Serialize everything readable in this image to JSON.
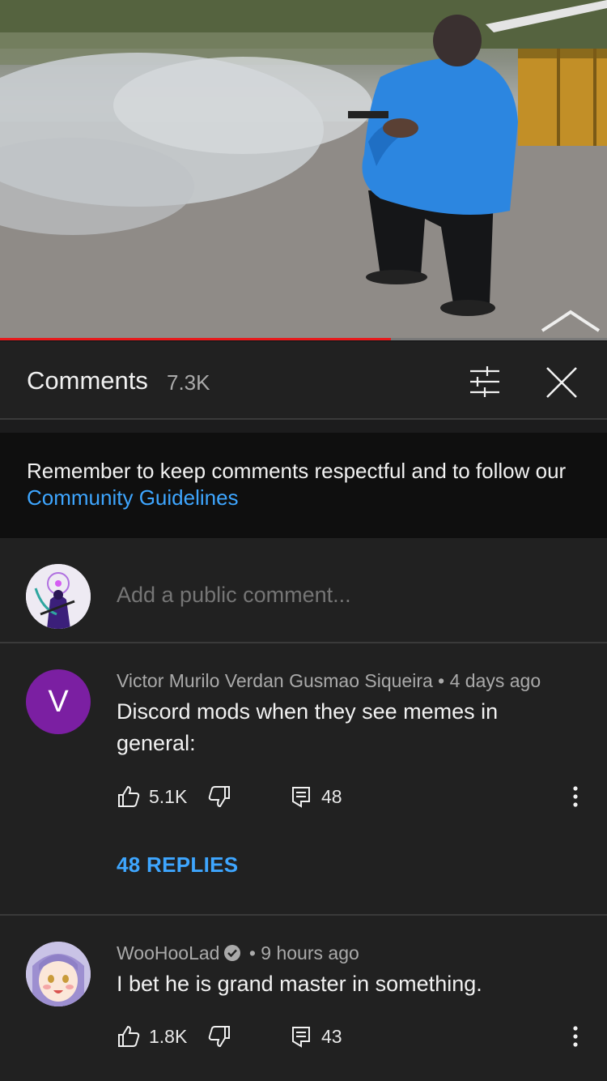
{
  "video": {
    "progress": 0.644
  },
  "header": {
    "title": "Comments",
    "count": "7.3K",
    "filter_icon": "sliders-icon",
    "close_icon": "close-icon"
  },
  "notice": {
    "text": "Remember to keep comments respectful and to follow our ",
    "link": "Community Guidelines"
  },
  "add_comment": {
    "placeholder": "Add a public comment..."
  },
  "comments": [
    {
      "avatar_letter": "V",
      "avatar_color": "#7b1fa2",
      "author": "Victor Murilo Verdan Gusmao Siqueira",
      "separator": "•",
      "time": "4 days ago",
      "text": "Discord mods when they see memes in general:",
      "likes": "5.1K",
      "replies_count": "48",
      "replies_label": "48 REPLIES"
    },
    {
      "author": "WooHooLad",
      "verified": true,
      "separator": "•",
      "time": "9 hours ago",
      "text": "I bet he is grand master in something.",
      "likes": "1.8K",
      "replies_count": "43"
    }
  ],
  "colors": {
    "accent_link": "#3ea6ff",
    "progress": "#e8191b",
    "background": "#212121"
  }
}
